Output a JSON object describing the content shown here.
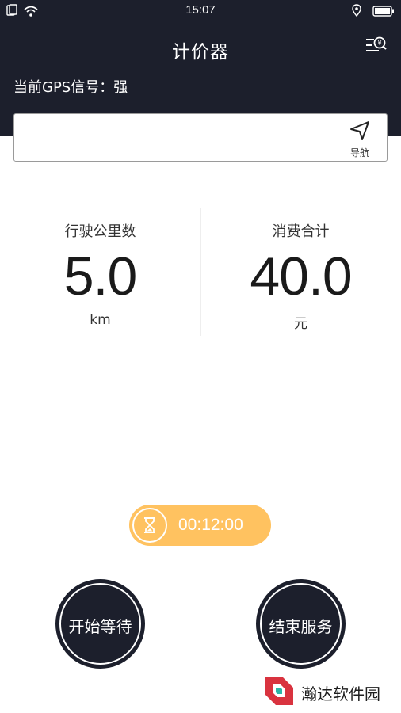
{
  "status_bar": {
    "time": "15:07",
    "icons": [
      "sim-icon",
      "wifi-icon",
      "location-icon",
      "battery-icon"
    ]
  },
  "header": {
    "title": "计价器",
    "fare_icon": "fare-list-icon",
    "gps_status": "当前GPS信号：强"
  },
  "destination": {
    "value": "",
    "nav_label": "导航",
    "nav_icon": "navigation-arrow-icon"
  },
  "stats": {
    "distance": {
      "label": "行驶公里数",
      "value": "5.0",
      "unit": "km"
    },
    "cost": {
      "label": "消费合计",
      "value": "40.0",
      "unit": "元"
    }
  },
  "timer": {
    "icon": "hourglass-icon",
    "value": "00:12:00"
  },
  "actions": {
    "start_wait": "开始等待",
    "end_service": "结束服务"
  },
  "watermark": {
    "text": "瀚达软件园"
  },
  "colors": {
    "dark": "#1c1f2c",
    "accent": "#ffc260",
    "white": "#ffffff"
  }
}
